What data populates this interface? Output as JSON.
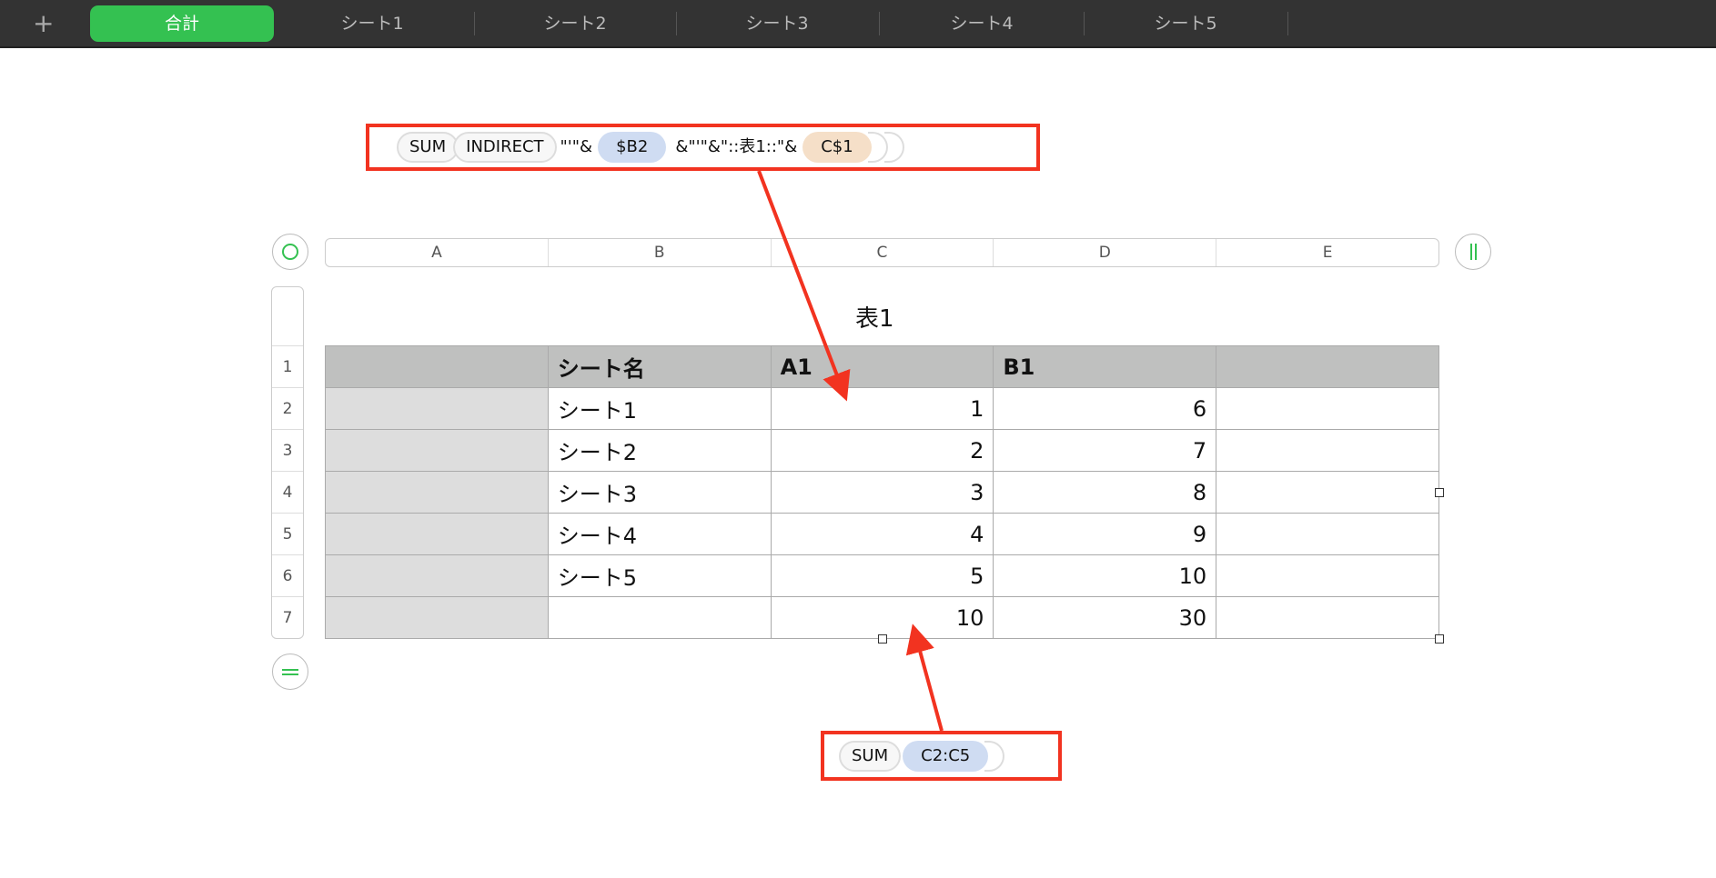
{
  "tabs": [
    {
      "label": "合計",
      "active": true
    },
    {
      "label": "シート1"
    },
    {
      "label": "シート2"
    },
    {
      "label": "シート3"
    },
    {
      "label": "シート4"
    },
    {
      "label": "シート5"
    }
  ],
  "add_tab": "+",
  "formula_top": {
    "func1": "SUM",
    "func2": "INDIRECT",
    "t1": "\"'\"&",
    "ref1": "$B2",
    "t2": "&\"'\"&\"::表1::\"&",
    "ref2": "C$1"
  },
  "formula_bottom": {
    "func": "SUM",
    "ref": "C2:C5"
  },
  "columns": [
    "A",
    "B",
    "C",
    "D",
    "E"
  ],
  "rows": [
    "1",
    "2",
    "3",
    "4",
    "5",
    "6",
    "7"
  ],
  "table_title": "表1",
  "table": [
    [
      "",
      "シート名",
      "A1",
      "B1",
      ""
    ],
    [
      "",
      "シート1",
      "1",
      "6",
      ""
    ],
    [
      "",
      "シート2",
      "2",
      "7",
      ""
    ],
    [
      "",
      "シート3",
      "3",
      "8",
      ""
    ],
    [
      "",
      "シート4",
      "4",
      "9",
      ""
    ],
    [
      "",
      "シート5",
      "5",
      "10",
      ""
    ],
    [
      "",
      "",
      "10",
      "30",
      ""
    ]
  ],
  "colors": {
    "accent": "#34c151",
    "annotation": "#f23320",
    "ref_blue": "#cfdcf2",
    "ref_orange": "#f5dfc8"
  }
}
